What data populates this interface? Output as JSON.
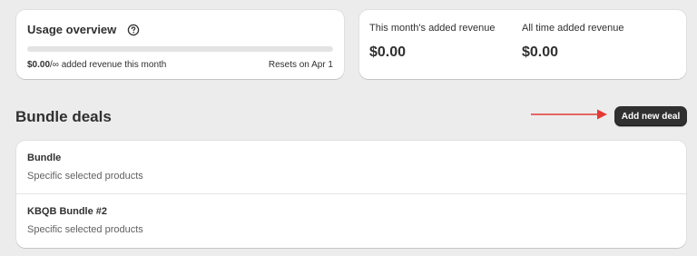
{
  "usage": {
    "title": "Usage overview",
    "help_icon": "question-circle-icon",
    "progress_fraction": 0,
    "amount": "$0.00",
    "limit_text": "/∞ added revenue this month",
    "reset_text": "Resets on Apr 1"
  },
  "revenue": {
    "month_label": "This month's added revenue",
    "month_value": "$0.00",
    "alltime_label": "All time added revenue",
    "alltime_value": "$0.00"
  },
  "section": {
    "title": "Bundle deals",
    "add_button_label": "Add new deal",
    "arrow_color": "#e53935"
  },
  "deals": [
    {
      "name": "Bundle",
      "subtitle": "Specific selected products"
    },
    {
      "name": "KBQB Bundle #2",
      "subtitle": "Specific selected products"
    }
  ]
}
